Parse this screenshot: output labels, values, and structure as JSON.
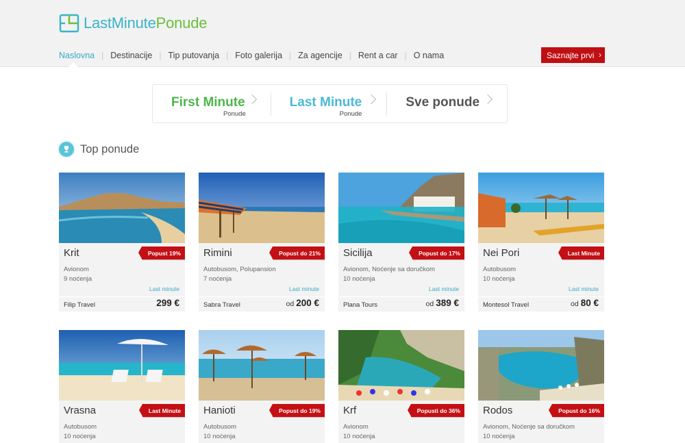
{
  "logo": {
    "part1": "LastMinute",
    "part2": "Ponude",
    "icon": "logo-icon"
  },
  "nav": {
    "items": [
      "Naslovna",
      "Destinacije",
      "Tip putovanja",
      "Foto galerija",
      "Za agencije",
      "Rent a car",
      "O nama"
    ],
    "separator": "|",
    "active": "Naslovna"
  },
  "cta": {
    "label": "Saznajte prvi",
    "icon": "chevron-right-icon"
  },
  "offers": [
    {
      "title": "First Minute",
      "subtitle": "Ponude",
      "color": "#4cb848"
    },
    {
      "title": "Last Minute",
      "subtitle": "Ponude",
      "color": "#4ab9d4"
    },
    {
      "title": "Sve ponude",
      "subtitle": "",
      "color": "#555555"
    }
  ],
  "section": {
    "title": "Top ponude",
    "icon": "trophy-icon"
  },
  "cards": [
    {
      "name": "Krit",
      "badge": "Popust 19%",
      "transport": "Avionom",
      "nights": "9 noćenja",
      "tag": "Last minute",
      "agency": "Filip Travel",
      "price_prefix": "",
      "price": "299 €"
    },
    {
      "name": "Rimini",
      "badge": "Popust do 21%",
      "transport": "Autobusom, Polupansion",
      "nights": "7 noćenja",
      "tag": "Last minute",
      "agency": "Sabra Travel",
      "price_prefix": "od",
      "price": "200 €"
    },
    {
      "name": "Sicilija",
      "badge": "Popust do 17%",
      "transport": "Avionom, Noćenje sa doručkom",
      "nights": "10 noćenja",
      "tag": "Last minute",
      "agency": "Plana Tours",
      "price_prefix": "od",
      "price": "389 €"
    },
    {
      "name": "Nei Pori",
      "badge": "Last Minute",
      "transport": "Autobusom",
      "nights": "10 noćenja",
      "tag": "Last minute",
      "agency": "Montesol Travel",
      "price_prefix": "od",
      "price": "80 €"
    },
    {
      "name": "Vrasna",
      "badge": "Last Minute",
      "transport": "Autobusom",
      "nights": "10 noćenja"
    },
    {
      "name": "Hanioti",
      "badge": "Popust do 19%",
      "transport": "Autobusom",
      "nights": "10 noćenja"
    },
    {
      "name": "Krf",
      "badge": "Popusti do 36%",
      "transport": "Avionom",
      "nights": "10 noćenja"
    },
    {
      "name": "Rodos",
      "badge": "Popust do 16%",
      "transport": "Avionom, Noćenje sa doručkom",
      "nights": "10 noćenja"
    }
  ],
  "colors": {
    "accent": "#37a9c4",
    "cta": "#c00f12",
    "badge": "#c40f14",
    "first_minute": "#4cb848",
    "last_minute": "#4ab9d4"
  }
}
